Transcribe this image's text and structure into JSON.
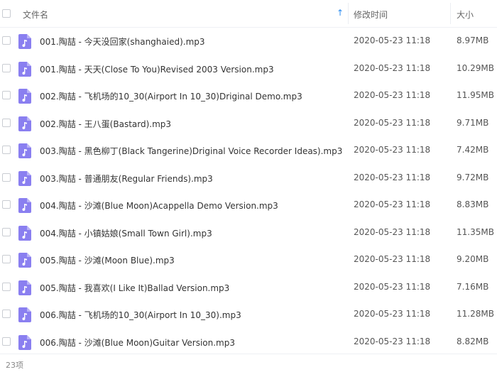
{
  "header": {
    "name_label": "文件名",
    "sort_arrow": "↑",
    "date_label": "修改时间",
    "size_label": "大小"
  },
  "icon_color": "#8a7ff0",
  "files": [
    {
      "name": "001.陶喆 - 今天没回家(shanghaied).mp3",
      "date": "2020-05-23 11:18",
      "size": "8.97MB"
    },
    {
      "name": "001.陶喆 - 天天(Close To You)Revised 2003 Version.mp3",
      "date": "2020-05-23 11:18",
      "size": "10.29MB"
    },
    {
      "name": "002.陶喆 - 飞机场的10_30(Airport In 10_30)Driginal Demo.mp3",
      "date": "2020-05-23 11:18",
      "size": "11.95MB"
    },
    {
      "name": "002.陶喆 - 王八蛋(Bastard).mp3",
      "date": "2020-05-23 11:18",
      "size": "9.71MB"
    },
    {
      "name": "003.陶喆 - 黑色柳丁(Black Tangerine)Driginal Voice Recorder Ideas).mp3",
      "date": "2020-05-23 11:18",
      "size": "7.42MB"
    },
    {
      "name": "003.陶喆 - 普通朋友(Regular Friends).mp3",
      "date": "2020-05-23 11:18",
      "size": "9.72MB"
    },
    {
      "name": "004.陶喆 - 沙滩(Blue Moon)Acappella Demo Version.mp3",
      "date": "2020-05-23 11:18",
      "size": "8.83MB"
    },
    {
      "name": "004.陶喆 - 小镇姑娘(Small Town Girl).mp3",
      "date": "2020-05-23 11:18",
      "size": "11.35MB"
    },
    {
      "name": "005.陶喆 - 沙滩(Moon Blue).mp3",
      "date": "2020-05-23 11:18",
      "size": "9.20MB"
    },
    {
      "name": "005.陶喆 - 我喜欢(I Like It)Ballad Version.mp3",
      "date": "2020-05-23 11:18",
      "size": "7.16MB"
    },
    {
      "name": "006.陶喆 - 飞机场的10_30(Airport In 10_30).mp3",
      "date": "2020-05-23 11:18",
      "size": "11.28MB"
    },
    {
      "name": "006.陶喆 - 沙滩(Blue Moon)Guitar Version.mp3",
      "date": "2020-05-23 11:18",
      "size": "8.82MB"
    }
  ],
  "footer": {
    "count_label": "23项"
  }
}
